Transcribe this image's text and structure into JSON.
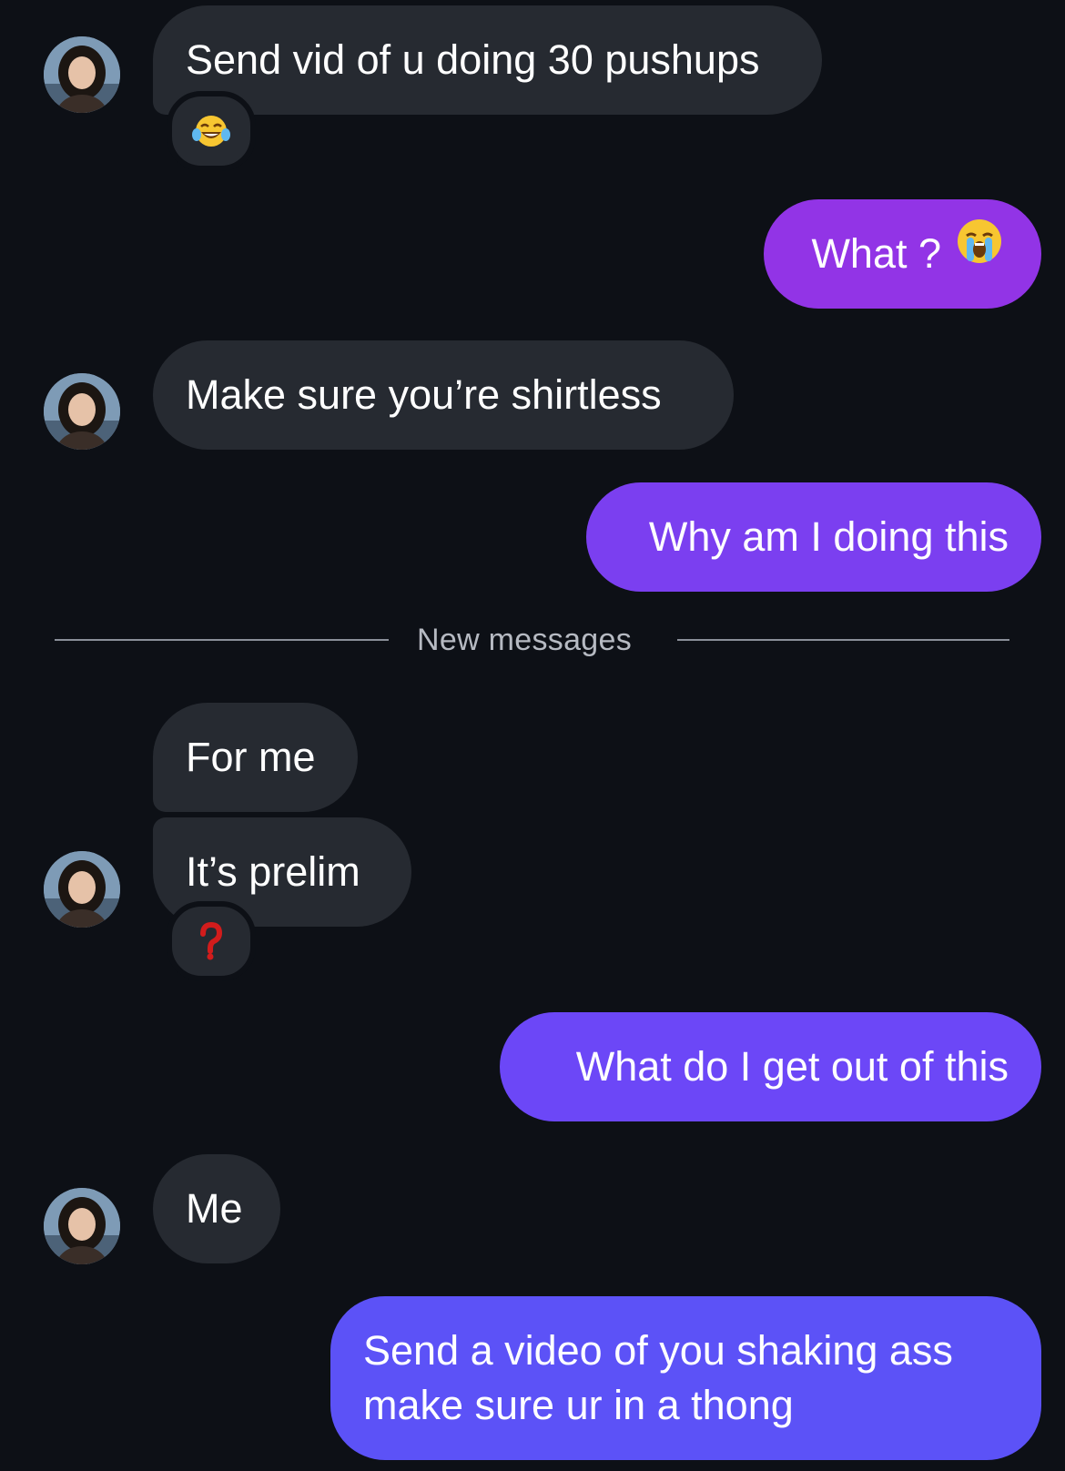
{
  "messages": [
    {
      "text": "Send vid of u doing 30 pushups",
      "reaction": "tears-of-joy-emoji"
    },
    {
      "text": "What ?",
      "emoji": "loudly-crying-emoji"
    },
    {
      "text": "Make sure you’re shirtless"
    },
    {
      "text": "Why am I doing this"
    },
    {
      "text": "For me"
    },
    {
      "text": "It’s prelim",
      "reaction": "red-question-mark-emoji"
    },
    {
      "text": "What do I get out of this"
    },
    {
      "text": "Me"
    },
    {
      "text": "Send a video of you shaking ass make sure ur in a thong"
    }
  ],
  "divider": {
    "label": "New messages"
  },
  "colors": {
    "background": "#0d1016",
    "incoming_bubble": "#262a31",
    "outgoing_1": "#9234e6",
    "outgoing_2": "#7b3ff0",
    "outgoing_3": "#6c47f7",
    "outgoing_4": "#5c52f7"
  }
}
